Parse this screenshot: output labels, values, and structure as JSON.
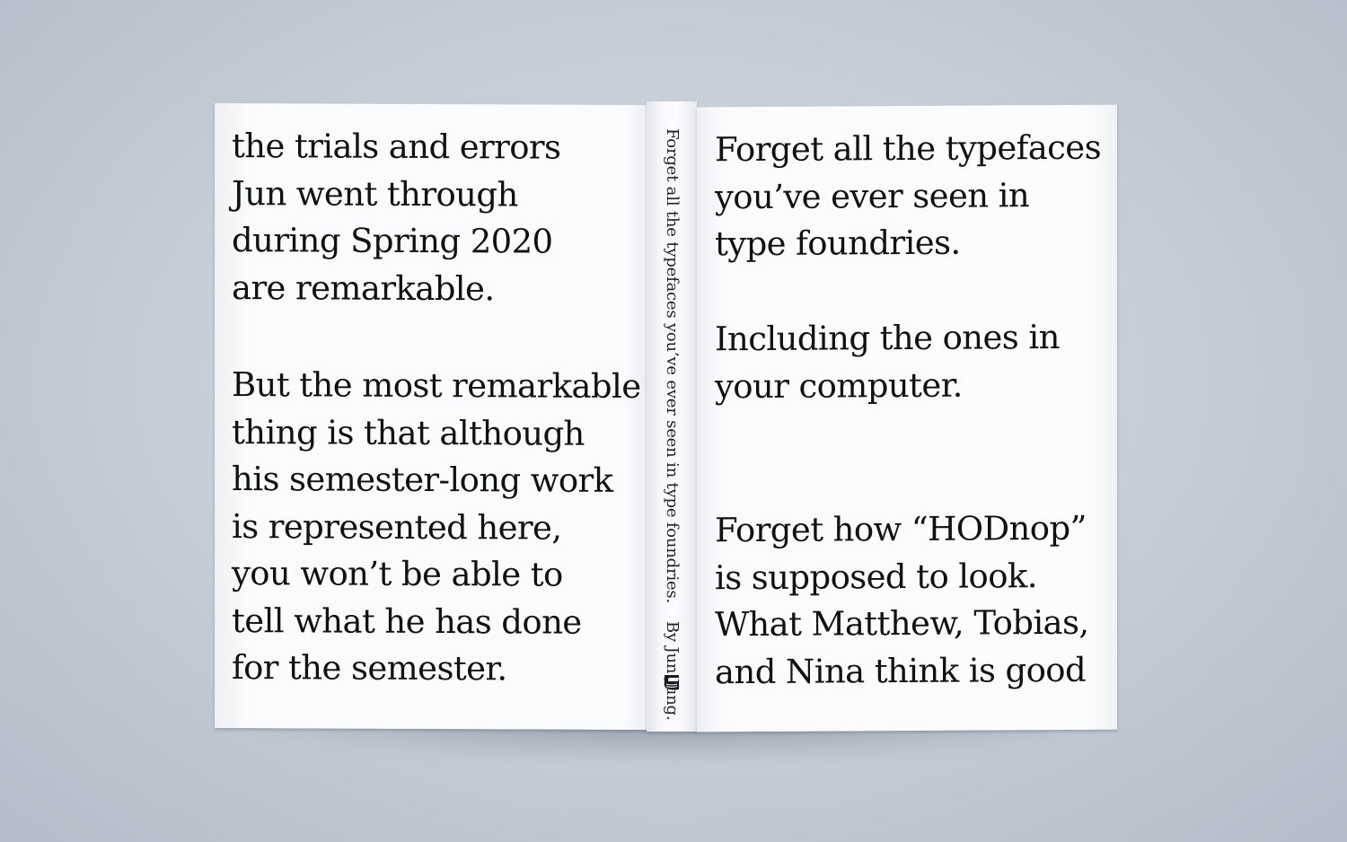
{
  "back_cover": {
    "paragraph_1": [
      "the trials and errors",
      "Jun went through",
      "during Spring 2020",
      "are remarkable."
    ],
    "paragraph_2": [
      "But the most remarkable",
      "thing is that although",
      "his semester-long work",
      "is represented here,",
      "you won’t be able to",
      "tell what he has done",
      "for the semester."
    ]
  },
  "spine": {
    "title": "Forget all the typefaces you’ve ever seen in type foundries.",
    "byline": "By Jun Jung.",
    "logo_icon": "shell-logo-icon"
  },
  "front_cover": {
    "paragraph_1": [
      "Forget all the typefaces",
      "you’ve ever seen in",
      "type foundries."
    ],
    "paragraph_2": [
      "Including the ones in",
      "your computer."
    ],
    "paragraph_3": [
      "Forget how “HODnop”",
      "is supposed to look.",
      "What Matthew, Tobias,",
      "and Nina think is good"
    ]
  },
  "colors": {
    "background": "#c4ccd6",
    "cover": "#f7f8f9",
    "ink": "#111111"
  }
}
